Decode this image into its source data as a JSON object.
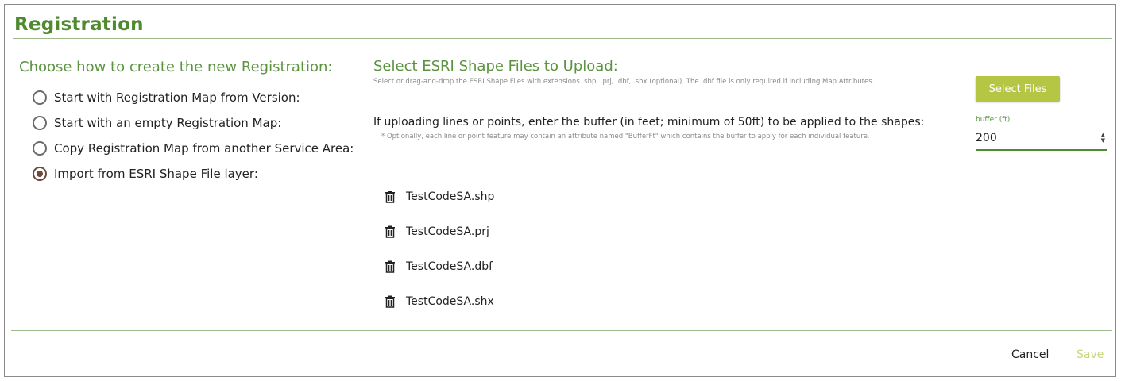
{
  "dialog": {
    "title": "Registration"
  },
  "left": {
    "heading": "Choose how to create the new Registration:",
    "options": [
      {
        "label": "Start with Registration Map from Version:",
        "checked": false
      },
      {
        "label": "Start with an empty Registration Map:",
        "checked": false
      },
      {
        "label": "Copy Registration Map from another Service Area:",
        "checked": false
      },
      {
        "label": "Import from ESRI Shape File layer:",
        "checked": true
      }
    ]
  },
  "upload": {
    "heading": "Select ESRI Shape Files to Upload:",
    "hint": "Select or drag-and-drop the ESRI Shape Files with extensions .shp, .prj, .dbf, .shx (optional). The .dbf file is only required if including Map Attributes.",
    "select_button": "Select Files"
  },
  "buffer": {
    "question": "If uploading lines or points, enter the buffer (in feet; minimum of 50ft) to be applied to the shapes:",
    "note": "* Optionally, each line or point feature may contain an attribute named \"BufferFt\" which contains the buffer to apply for each individual feature.",
    "label": "buffer (ft)",
    "value": "200"
  },
  "files": [
    {
      "name": "TestCodeSA.shp",
      "icon": "trash-icon"
    },
    {
      "name": "TestCodeSA.prj",
      "icon": "trash-icon"
    },
    {
      "name": "TestCodeSA.dbf",
      "icon": "trash-icon"
    },
    {
      "name": "TestCodeSA.shx",
      "icon": "trash-icon"
    }
  ],
  "footer": {
    "cancel_label": "Cancel",
    "save_label": "Save"
  },
  "colors": {
    "accent_green": "#4f8a2e",
    "button_lime": "#b5c644",
    "save_disabled": "#c8d77a",
    "radio_selected": "#6b4a3a"
  }
}
